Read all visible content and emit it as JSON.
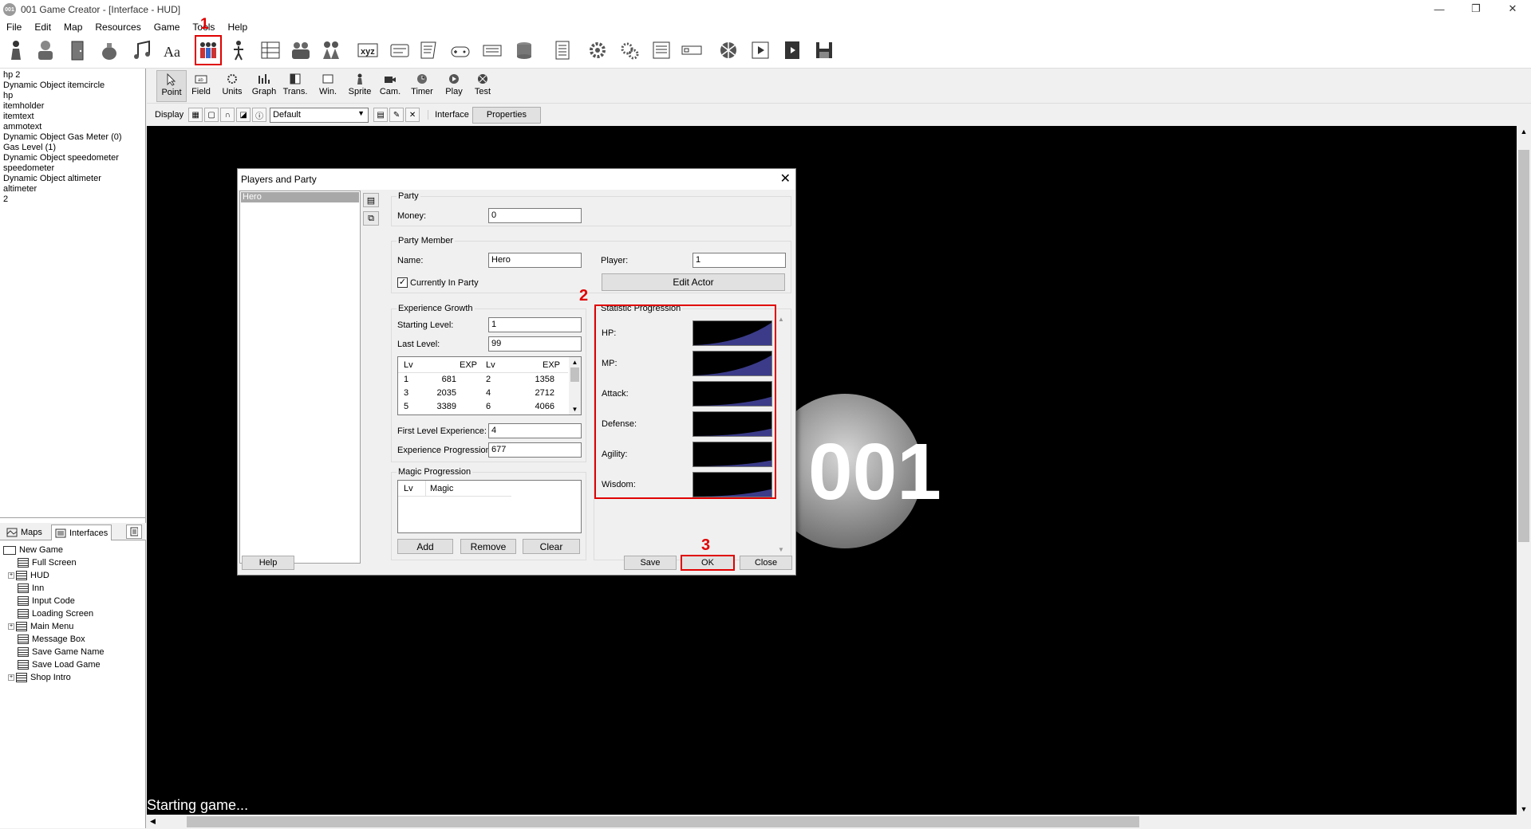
{
  "window": {
    "title": "001 Game Creator - [Interface - HUD]",
    "app_icon_text": "001"
  },
  "menu": [
    "File",
    "Edit",
    "Map",
    "Resources",
    "Game",
    "Tools",
    "Help"
  ],
  "toolbar_icons": [
    "actor-icon",
    "character-icon",
    "door-icon",
    "bag-icon",
    "music-icon",
    "font-icon",
    "players-party-icon",
    "person-icon",
    "database-icon",
    "group-icon",
    "duo-icon",
    "xyz-icon",
    "card-icon",
    "note-icon",
    "gamepad-icon",
    "device-icon",
    "disk-icon",
    "list-icon",
    "gear-icon",
    "gears-icon",
    "document-icon",
    "text-field-icon",
    "ball-icon",
    "video-icon",
    "film-icon",
    "save-icon"
  ],
  "objects": [
    "hp 2",
    "Dynamic Object itemcircle",
    "hp",
    "itemholder",
    "itemtext",
    "ammotext",
    "Dynamic Object Gas Meter (0)",
    "Gas Level (1)",
    "Dynamic Object speedometer",
    "speedometer",
    "Dynamic Object altimeter",
    "altimeter",
    "2"
  ],
  "left_tabs": {
    "maps": "Maps",
    "interfaces": "Interfaces"
  },
  "tree": {
    "root": "New Game",
    "items": [
      {
        "label": "Full Screen",
        "expandable": false
      },
      {
        "label": "HUD",
        "expandable": true
      },
      {
        "label": "Inn",
        "expandable": false
      },
      {
        "label": "Input Code",
        "expandable": false
      },
      {
        "label": "Loading Screen",
        "expandable": false
      },
      {
        "label": "Main Menu",
        "expandable": true
      },
      {
        "label": "Message Box",
        "expandable": false
      },
      {
        "label": "Save Game Name",
        "expandable": false
      },
      {
        "label": "Save Load Game",
        "expandable": false
      },
      {
        "label": "Shop Intro",
        "expandable": true
      }
    ]
  },
  "modes": [
    "Point",
    "Field",
    "Units",
    "Graph",
    "Trans.",
    "Win.",
    "Sprite",
    "Cam.",
    "Timer",
    "Play",
    "Test"
  ],
  "display_bar": {
    "display_label": "Display",
    "select_value": "Default",
    "interface_label": "Interface",
    "properties_label": "Properties"
  },
  "canvas": {
    "status": "Starting game...",
    "logo_text": "001"
  },
  "dialog": {
    "title": "Players and Party",
    "list_items": [
      "Hero"
    ],
    "party": {
      "group": "Party",
      "money_label": "Money:",
      "money": "0"
    },
    "member": {
      "group": "Party Member",
      "name_label": "Name:",
      "name": "Hero",
      "player_label": "Player:",
      "player": "1",
      "in_party_label": "Currently In Party",
      "in_party": true,
      "edit_actor": "Edit Actor"
    },
    "exp": {
      "group": "Experience Growth",
      "start_label": "Starting Level:",
      "start": "1",
      "last_label": "Last Level:",
      "last": "99",
      "headers": [
        "Lv",
        "EXP",
        "Lv",
        "EXP"
      ],
      "rows": [
        [
          "1",
          "681",
          "2",
          "1358"
        ],
        [
          "3",
          "2035",
          "4",
          "2712"
        ],
        [
          "5",
          "3389",
          "6",
          "4066"
        ]
      ],
      "first_label": "First Level Experience:",
      "first": "4",
      "prog_label": "Experience Progression:",
      "prog": "677"
    },
    "magic": {
      "group": "Magic Progression",
      "headers": [
        "Lv",
        "Magic"
      ],
      "add": "Add",
      "remove": "Remove",
      "clear": "Clear"
    },
    "stats": {
      "group": "Statistic Progression",
      "items": [
        "HP:",
        "MP:",
        "Attack:",
        "Defense:",
        "Agility:",
        "Wisdom:"
      ]
    },
    "buttons": {
      "help": "Help",
      "save": "Save",
      "ok": "OK",
      "close": "Close"
    }
  },
  "annotations": [
    "1",
    "2",
    "3"
  ],
  "colors": {
    "highlight": "#e00000",
    "graph_fill": "#3b3b8a",
    "canvas": "#000000"
  }
}
